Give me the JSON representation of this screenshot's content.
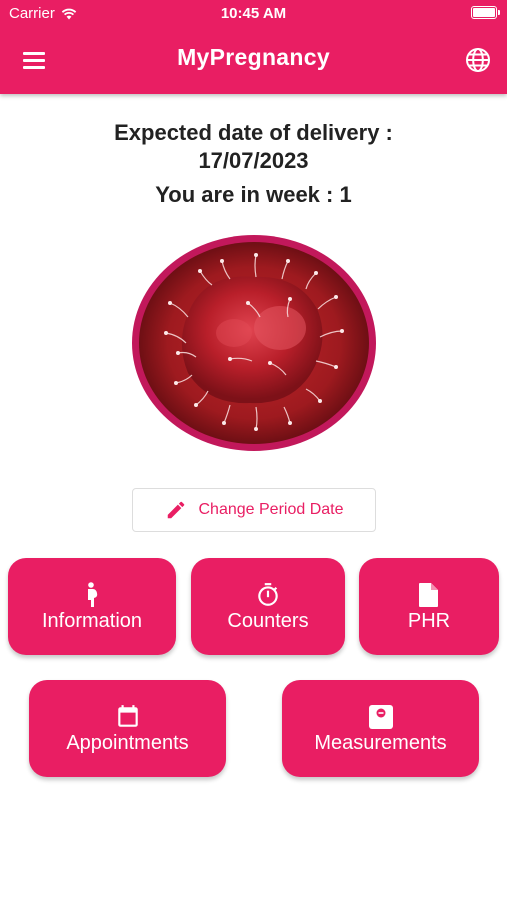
{
  "status_bar": {
    "carrier": "Carrier",
    "time": "10:45 AM"
  },
  "app_bar": {
    "title": "MyPregnancy",
    "menu_icon": "menu-icon",
    "language_icon": "globe-icon"
  },
  "delivery": {
    "label": "Expected date of delivery :",
    "date": "17/07/2023"
  },
  "week": {
    "text": "You are in week : 1"
  },
  "change_period": {
    "label": "Change Period Date",
    "icon": "pencil-icon"
  },
  "tiles": [
    {
      "label": "Information",
      "icon": "pregnant-woman-icon"
    },
    {
      "label": "Counters",
      "icon": "stopwatch-icon"
    },
    {
      "label": "PHR",
      "icon": "document-icon"
    },
    {
      "label": "Appointments",
      "icon": "calendar-icon"
    },
    {
      "label": "Measurements",
      "icon": "scale-icon"
    }
  ],
  "colors": {
    "primary": "#e91e63",
    "text": "#222222",
    "background": "#ffffff"
  }
}
